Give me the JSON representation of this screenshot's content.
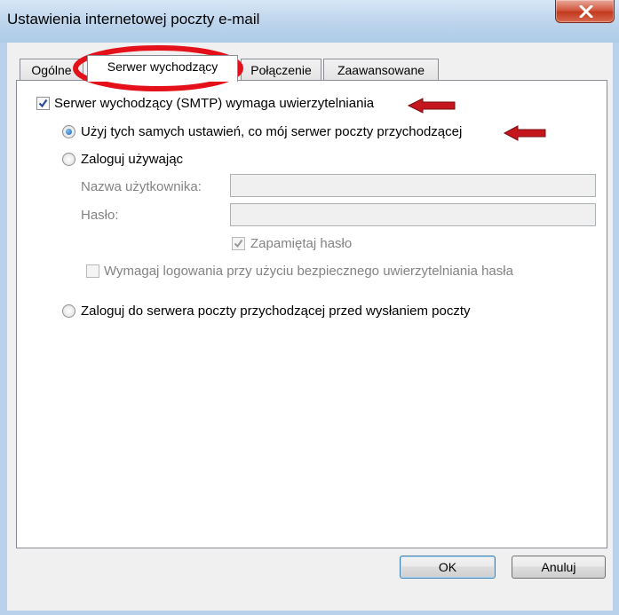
{
  "window": {
    "title": "Ustawienia internetowej poczty e-mail",
    "close_label": "X"
  },
  "tabs": [
    {
      "label": "Ogólne",
      "active": false
    },
    {
      "label": "Serwer wychodzący",
      "active": true
    },
    {
      "label": "Połączenie",
      "active": false
    },
    {
      "label": "Zaawansowane",
      "active": false
    }
  ],
  "outgoing": {
    "smtp_auth": {
      "label": "Serwer wychodzący (SMTP) wymaga uwierzytelniania",
      "checked": true
    },
    "use_same_settings": {
      "label": "Użyj tych samych ustawień, co mój serwer poczty przychodzącej",
      "selected": true
    },
    "log_on_using": {
      "label": "Zaloguj używając",
      "selected": false
    },
    "username": {
      "label": "Nazwa użytkownika:",
      "value": ""
    },
    "password": {
      "label": "Hasło:",
      "value": ""
    },
    "remember_password": {
      "label": "Zapamiętaj hasło",
      "checked": true,
      "disabled": true
    },
    "require_spa": {
      "label": "Wymagaj logowania przy użyciu bezpiecznego uwierzytelniania hasła",
      "checked": false,
      "disabled": true
    },
    "log_on_incoming_first": {
      "label": "Zaloguj do serwera poczty przychodzącej przed wysłaniem poczty",
      "selected": false
    }
  },
  "buttons": {
    "ok": "OK",
    "cancel": "Anuluj"
  },
  "colors": {
    "annotation_red": "#e4101a",
    "arrow_red": "#c4161c",
    "selected_radio_blue": "#1d5fab"
  }
}
